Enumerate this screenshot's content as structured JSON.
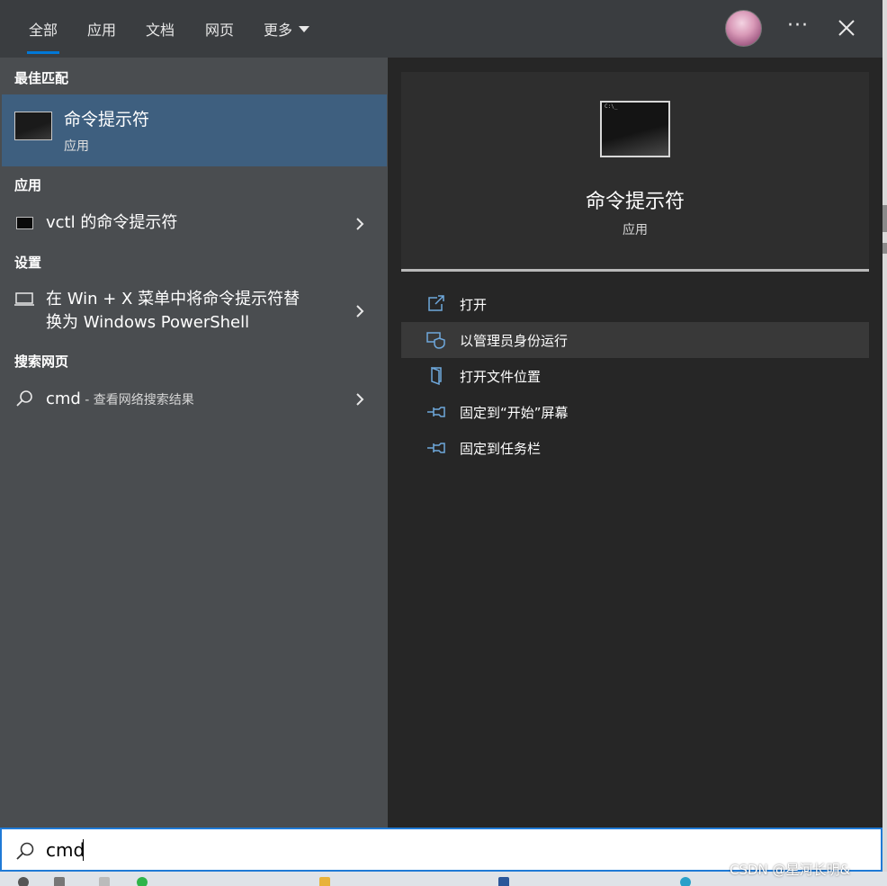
{
  "tabs": [
    {
      "label": "全部",
      "active": true
    },
    {
      "label": "应用"
    },
    {
      "label": "文档"
    },
    {
      "label": "网页"
    },
    {
      "label": "更多"
    }
  ],
  "header": {
    "more_icon": "ellipsis-icon",
    "close_icon": "close-icon",
    "avatar": "user-avatar"
  },
  "left": {
    "best_match_heading": "最佳匹配",
    "best_match": {
      "title": "命令提示符",
      "subtitle": "应用",
      "icon": "command-prompt-icon"
    },
    "apps_heading": "应用",
    "apps": [
      {
        "label": "vctl 的命令提示符",
        "icon": "command-prompt-icon"
      }
    ],
    "settings_heading": "设置",
    "settings": [
      {
        "label_line1": "在 Win + X 菜单中将命令提示符替",
        "label_line2": "换为 Windows PowerShell",
        "icon": "laptop-icon"
      }
    ],
    "web_heading": "搜索网页",
    "web": [
      {
        "query": "cmd",
        "suffix": " - 查看网络搜索结果",
        "icon": "search-icon"
      }
    ]
  },
  "preview": {
    "title": "命令提示符",
    "subtitle": "应用",
    "icon": "command-prompt-icon",
    "actions": [
      {
        "label": "打开",
        "icon": "open-icon"
      },
      {
        "label": "以管理员身份运行",
        "icon": "shield-icon"
      },
      {
        "label": "打开文件位置",
        "icon": "file-location-icon"
      },
      {
        "label": "固定到“开始”屏幕",
        "icon": "pin-icon"
      },
      {
        "label": "固定到任务栏",
        "icon": "pin-icon"
      }
    ]
  },
  "search": {
    "value": "cmd",
    "icon": "search-icon"
  },
  "watermark": "CSDN @星河长明&",
  "colors": {
    "accent": "#0078d7",
    "selected_bg": "#3e5f7f",
    "left_bg": "#4a4d50",
    "right_bg": "#262626"
  }
}
